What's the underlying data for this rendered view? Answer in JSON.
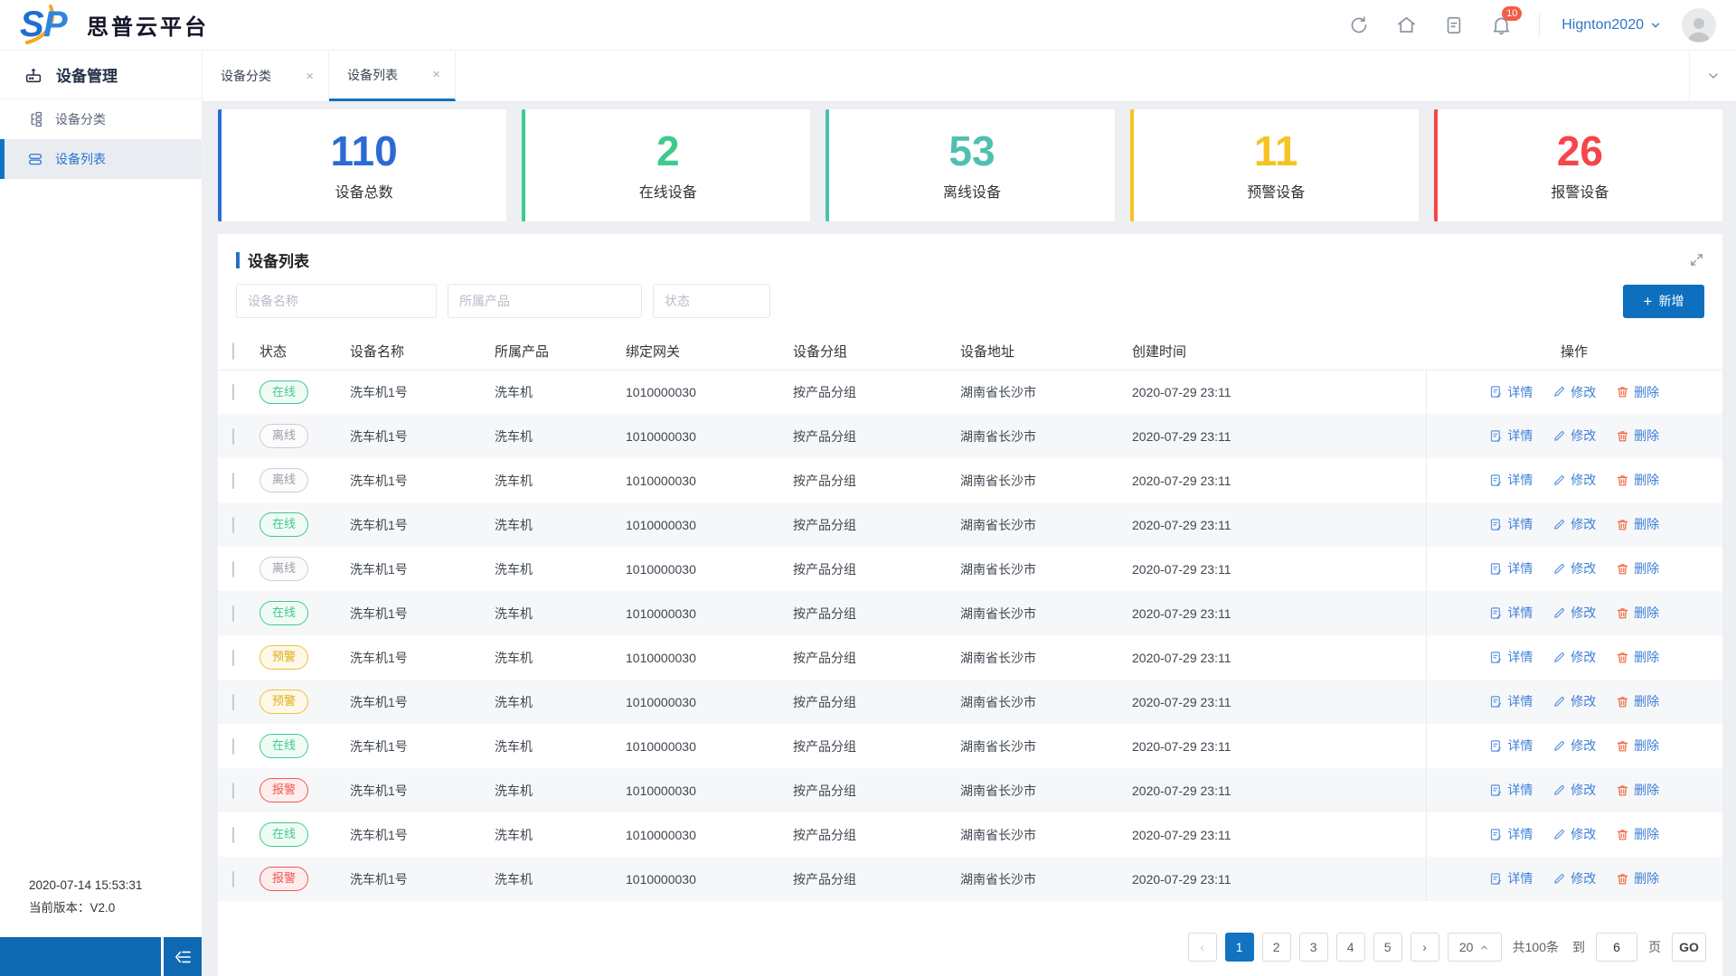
{
  "brand": {
    "logo_text": "SP",
    "title": "思普云平台"
  },
  "topbar": {
    "username": "Hignton2020",
    "badge_count": "10"
  },
  "icons": {
    "close": "×",
    "prev": "‹",
    "next": "›",
    "names": [
      "refresh-icon",
      "home-icon",
      "document-icon",
      "bell-icon",
      "chevron-down-icon",
      "avatar-person-icon",
      "expand-icon",
      "plus-icon",
      "detail-icon",
      "edit-icon",
      "delete-icon",
      "collapse-icon",
      "close-icon"
    ]
  },
  "sidebar": {
    "menu_title": "设备管理",
    "items": [
      {
        "label": "设备分类",
        "active": false
      },
      {
        "label": "设备列表",
        "active": true
      }
    ],
    "footer": {
      "timestamp": "2020-07-14 15:53:31",
      "version_label": "当前版本：V2.0"
    }
  },
  "tabs": [
    {
      "label": "设备分类",
      "active": false
    },
    {
      "label": "设备列表",
      "active": true
    }
  ],
  "stats": [
    {
      "value": "110",
      "label": "设备总数",
      "color": "#2b6bd4"
    },
    {
      "value": "2",
      "label": "在线设备",
      "color": "#3ecb8c"
    },
    {
      "value": "53",
      "label": "离线设备",
      "color": "#4fc0b0"
    },
    {
      "value": "11",
      "label": "预警设备",
      "color": "#f5c324"
    },
    {
      "value": "26",
      "label": "报警设备",
      "color": "#f5454b"
    }
  ],
  "panel": {
    "title": "设备列表",
    "filters": [
      {
        "placeholder": "设备名称"
      },
      {
        "placeholder": "所属产品"
      },
      {
        "placeholder": "状态"
      }
    ],
    "add_button": "新增"
  },
  "status_colors": {
    "online": {
      "fg": "#3ecb8c",
      "bg": "#f1fbf6"
    },
    "offline": {
      "fg": "#9aa0a8",
      "bg": "#fbfbfc"
    },
    "warning": {
      "fg": "#e2ac14",
      "bg": "#fdf8e8"
    },
    "alarm": {
      "fg": "#f25650",
      "bg": "#fdeeed"
    }
  },
  "table": {
    "columns": [
      "状态",
      "设备名称",
      "所属产品",
      "绑定网关",
      "设备分组",
      "设备地址",
      "创建时间",
      "操作"
    ],
    "actions": {
      "detail": "详情",
      "edit": "修改",
      "delete": "删除"
    },
    "rows": [
      {
        "status": "在线",
        "status_type": "online",
        "name": "洗车机1号",
        "product": "洗车机",
        "gateway": "1010000030",
        "group": "按产品分组",
        "address": "湖南省长沙市",
        "created": "2020-07-29 23:11"
      },
      {
        "status": "离线",
        "status_type": "offline",
        "name": "洗车机1号",
        "product": "洗车机",
        "gateway": "1010000030",
        "group": "按产品分组",
        "address": "湖南省长沙市",
        "created": "2020-07-29 23:11"
      },
      {
        "status": "离线",
        "status_type": "offline",
        "name": "洗车机1号",
        "product": "洗车机",
        "gateway": "1010000030",
        "group": "按产品分组",
        "address": "湖南省长沙市",
        "created": "2020-07-29 23:11"
      },
      {
        "status": "在线",
        "status_type": "online",
        "name": "洗车机1号",
        "product": "洗车机",
        "gateway": "1010000030",
        "group": "按产品分组",
        "address": "湖南省长沙市",
        "created": "2020-07-29 23:11"
      },
      {
        "status": "离线",
        "status_type": "offline",
        "name": "洗车机1号",
        "product": "洗车机",
        "gateway": "1010000030",
        "group": "按产品分组",
        "address": "湖南省长沙市",
        "created": "2020-07-29 23:11"
      },
      {
        "status": "在线",
        "status_type": "online",
        "name": "洗车机1号",
        "product": "洗车机",
        "gateway": "1010000030",
        "group": "按产品分组",
        "address": "湖南省长沙市",
        "created": "2020-07-29 23:11"
      },
      {
        "status": "预警",
        "status_type": "warning",
        "name": "洗车机1号",
        "product": "洗车机",
        "gateway": "1010000030",
        "group": "按产品分组",
        "address": "湖南省长沙市",
        "created": "2020-07-29 23:11"
      },
      {
        "status": "预警",
        "status_type": "warning",
        "name": "洗车机1号",
        "product": "洗车机",
        "gateway": "1010000030",
        "group": "按产品分组",
        "address": "湖南省长沙市",
        "created": "2020-07-29 23:11"
      },
      {
        "status": "在线",
        "status_type": "online",
        "name": "洗车机1号",
        "product": "洗车机",
        "gateway": "1010000030",
        "group": "按产品分组",
        "address": "湖南省长沙市",
        "created": "2020-07-29 23:11"
      },
      {
        "status": "报警",
        "status_type": "alarm",
        "name": "洗车机1号",
        "product": "洗车机",
        "gateway": "1010000030",
        "group": "按产品分组",
        "address": "湖南省长沙市",
        "created": "2020-07-29 23:11"
      },
      {
        "status": "在线",
        "status_type": "online",
        "name": "洗车机1号",
        "product": "洗车机",
        "gateway": "1010000030",
        "group": "按产品分组",
        "address": "湖南省长沙市",
        "created": "2020-07-29 23:11"
      },
      {
        "status": "报警",
        "status_type": "alarm",
        "name": "洗车机1号",
        "product": "洗车机",
        "gateway": "1010000030",
        "group": "按产品分组",
        "address": "湖南省长沙市",
        "created": "2020-07-29 23:11"
      }
    ]
  },
  "pagination": {
    "pages": [
      "1",
      "2",
      "3",
      "4",
      "5"
    ],
    "active_page": "1",
    "page_size": "20",
    "total_text": "共100条",
    "goto_prefix": "到",
    "goto_value": "6",
    "goto_suffix": "页",
    "go_label": "GO"
  }
}
